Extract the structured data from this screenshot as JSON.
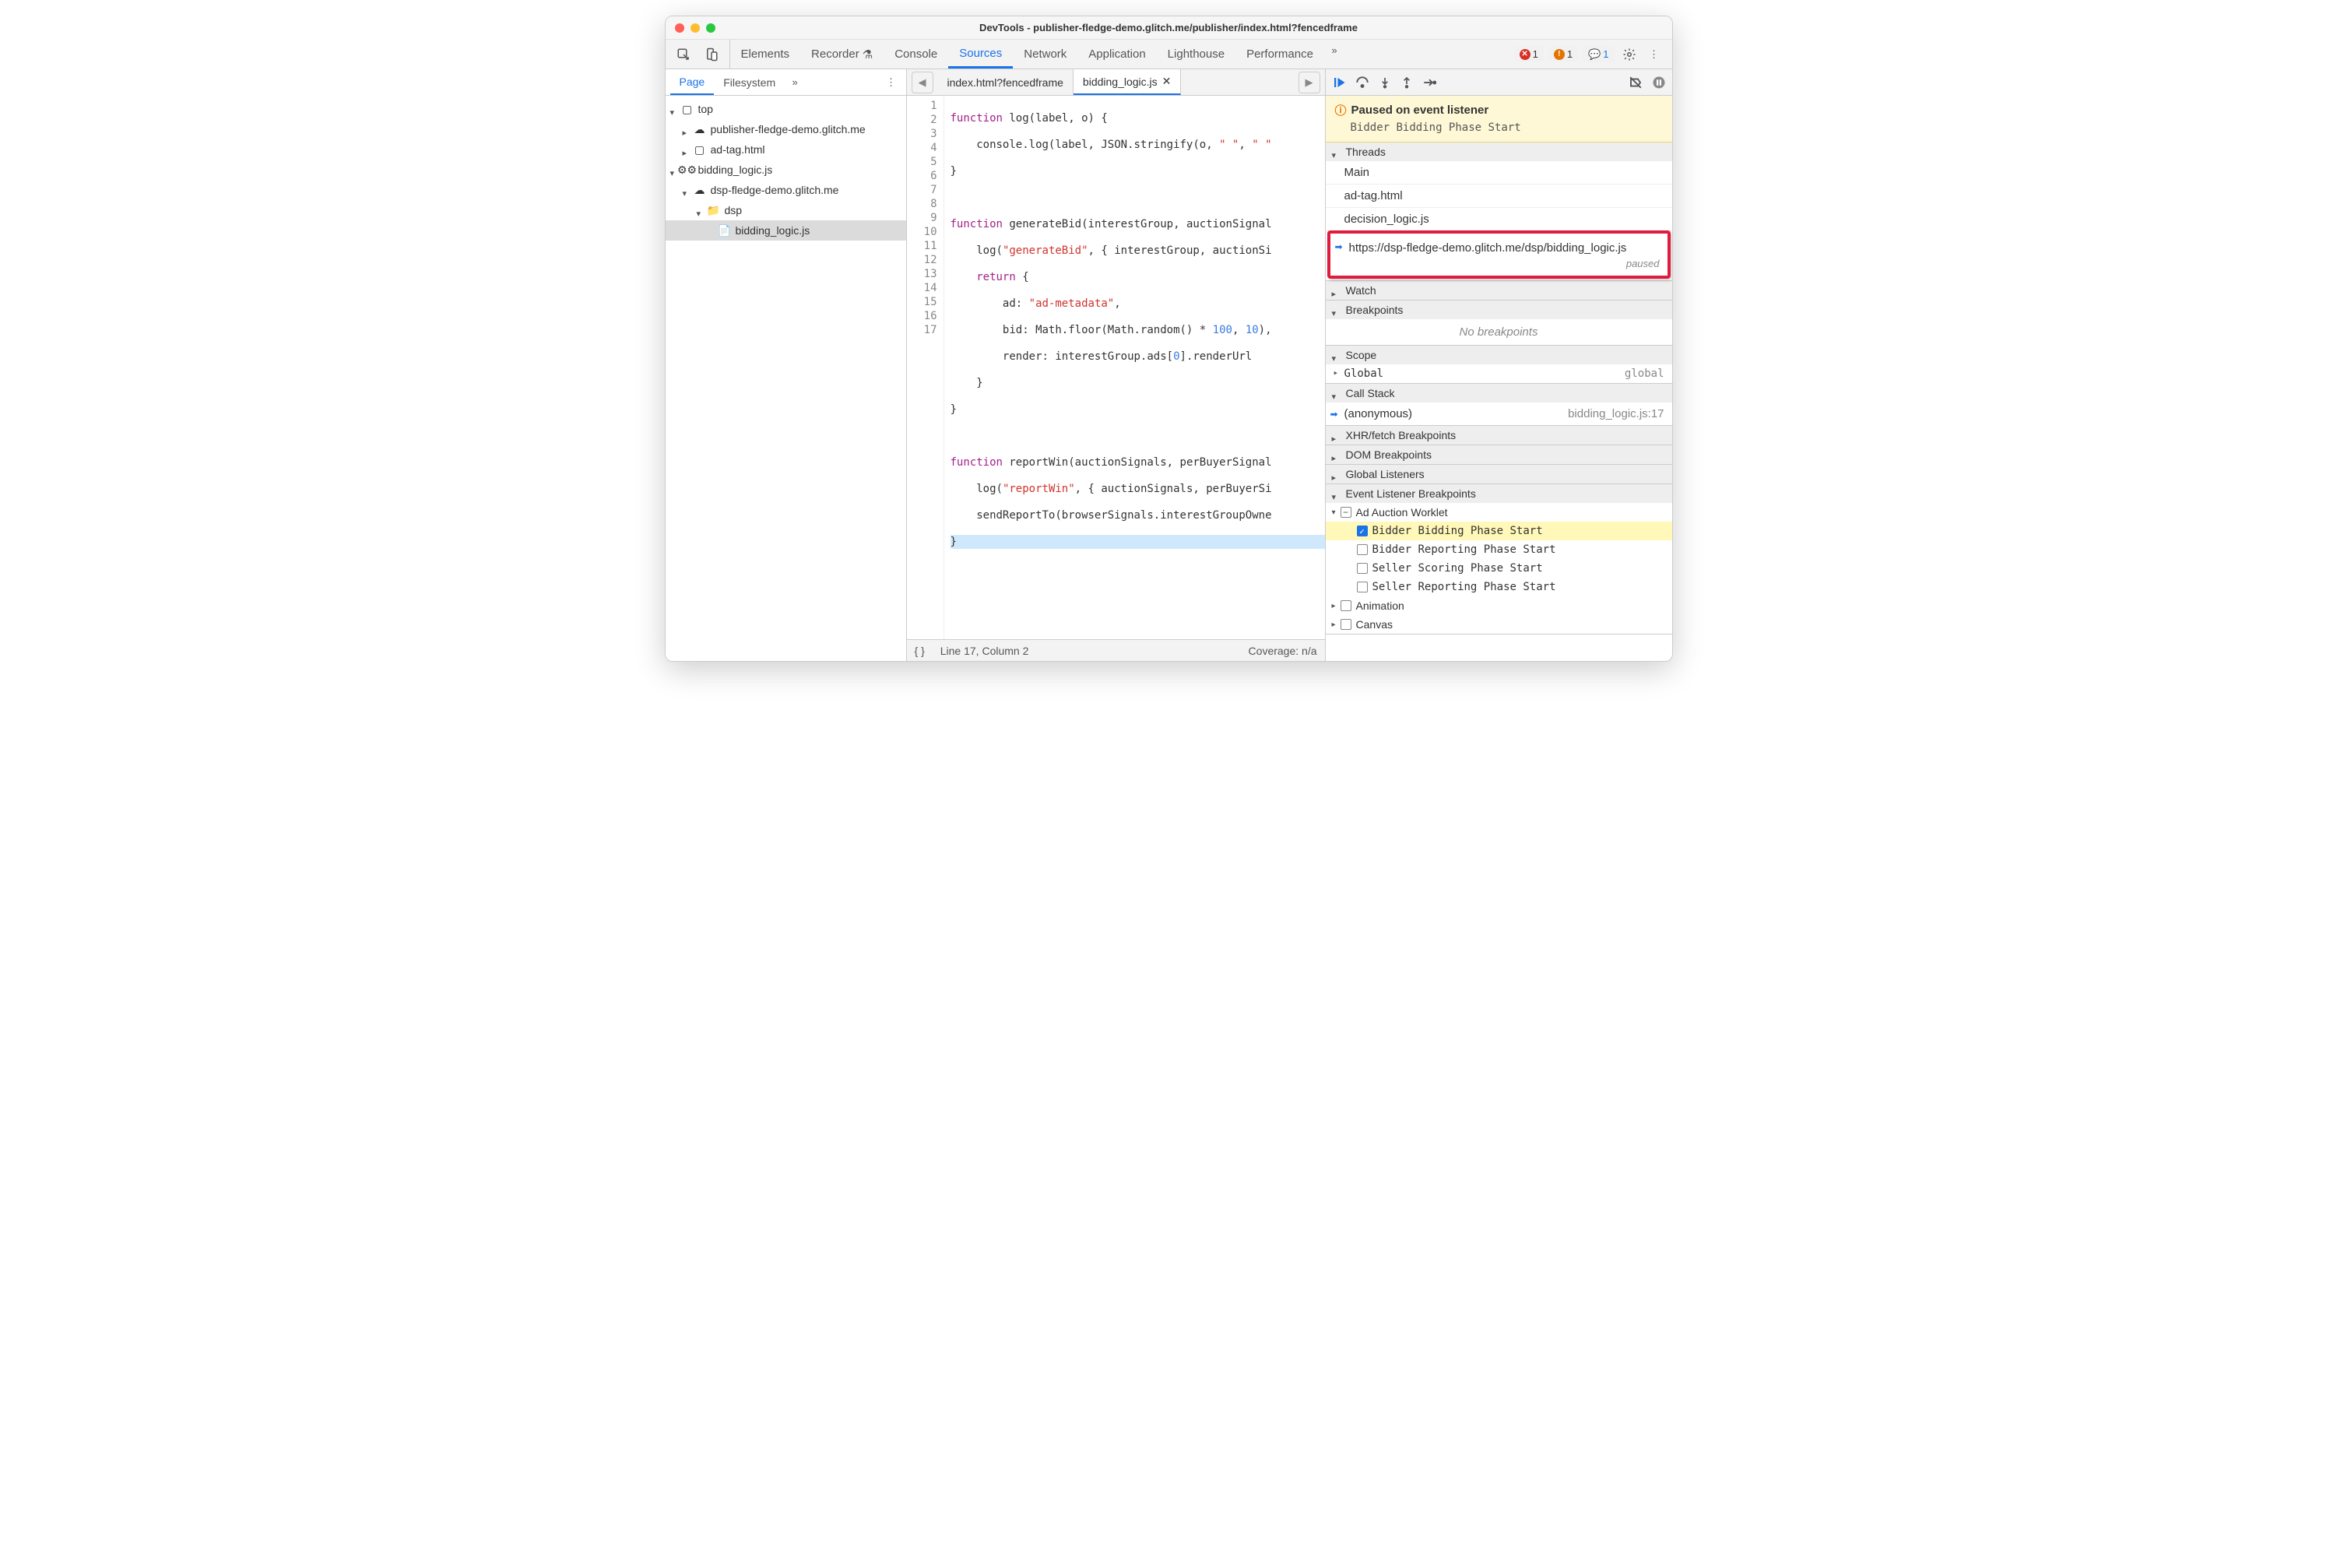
{
  "title": "DevTools - publisher-fledge-demo.glitch.me/publisher/index.html?fencedframe",
  "toolbar": {
    "tabs": [
      "Elements",
      "Recorder",
      "Console",
      "Sources",
      "Network",
      "Application",
      "Lighthouse",
      "Performance"
    ],
    "active": "Sources",
    "errors": "1",
    "warnings": "1",
    "issues": "1"
  },
  "leftTabs": {
    "items": [
      "Page",
      "Filesystem"
    ],
    "active": "Page"
  },
  "tree": {
    "top": "top",
    "pub": "publisher-fledge-demo.glitch.me",
    "adtag": "ad-tag.html",
    "blogic": "bidding_logic.js",
    "dsp": "dsp-fledge-demo.glitch.me",
    "dspdir": "dsp",
    "blogic2": "bidding_logic.js"
  },
  "centerTabs": {
    "items": [
      "index.html?fencedframe",
      "bidding_logic.js"
    ],
    "active": "bidding_logic.js"
  },
  "code": {
    "lines": 17,
    "l1a": "function",
    "l1b": " log(label, o) {",
    "l2a": "    console.log(label, JSON.stringify(o, ",
    "l2b": "\" \"",
    "l2c": ", ",
    "l2d": "\" \"",
    "l3": "}",
    "l4": "",
    "l5a": "function",
    "l5b": " generateBid(interestGroup, auctionSignal",
    "l6a": "    log(",
    "l6b": "\"generateBid\"",
    "l6c": ", { interestGroup, auctionSi",
    "l7a": "    ",
    "l7b": "return",
    "l7c": " {",
    "l8a": "        ad: ",
    "l8b": "\"ad-metadata\"",
    "l8c": ",",
    "l9a": "        bid: Math.floor(Math.random() * ",
    "l9b": "100",
    "l9c": ", ",
    "l9d": "10",
    "l9e": "),",
    "l10a": "        render: interestGroup.ads[",
    "l10b": "0",
    "l10c": "].renderUrl",
    "l11": "    }",
    "l12": "}",
    "l13": "",
    "l14a": "function",
    "l14b": " reportWin(auctionSignals, perBuyerSignal",
    "l15a": "    log(",
    "l15b": "\"reportWin\"",
    "l15c": ", { auctionSignals, perBuyerSi",
    "l16": "    sendReportTo(browserSignals.interestGroupOwne",
    "l17": "}"
  },
  "status": {
    "pos": "Line 17, Column 2",
    "cov": "Coverage: n/a"
  },
  "paused": {
    "title": "Paused on event listener",
    "sub": "Bidder Bidding Phase Start"
  },
  "threads": {
    "label": "Threads",
    "items": [
      "Main",
      "ad-tag.html",
      "decision_logic.js"
    ],
    "hl": "https://dsp-fledge-demo.glitch.me/dsp/bidding_logic.js",
    "hlSub": "paused"
  },
  "watch": "Watch",
  "bp": {
    "label": "Breakpoints",
    "empty": "No breakpoints"
  },
  "scope": {
    "label": "Scope",
    "global": "Global",
    "globalTag": "global"
  },
  "stack": {
    "label": "Call Stack",
    "fn": "(anonymous)",
    "loc": "bidding_logic.js:17"
  },
  "xhr": "XHR/fetch Breakpoints",
  "dom": "DOM Breakpoints",
  "gl": "Global Listeners",
  "evt": {
    "label": "Event Listener Breakpoints",
    "cat": "Ad Auction Worklet",
    "items": [
      "Bidder Bidding Phase Start",
      "Bidder Reporting Phase Start",
      "Seller Scoring Phase Start",
      "Seller Reporting Phase Start"
    ],
    "anim": "Animation",
    "canvas": "Canvas"
  }
}
